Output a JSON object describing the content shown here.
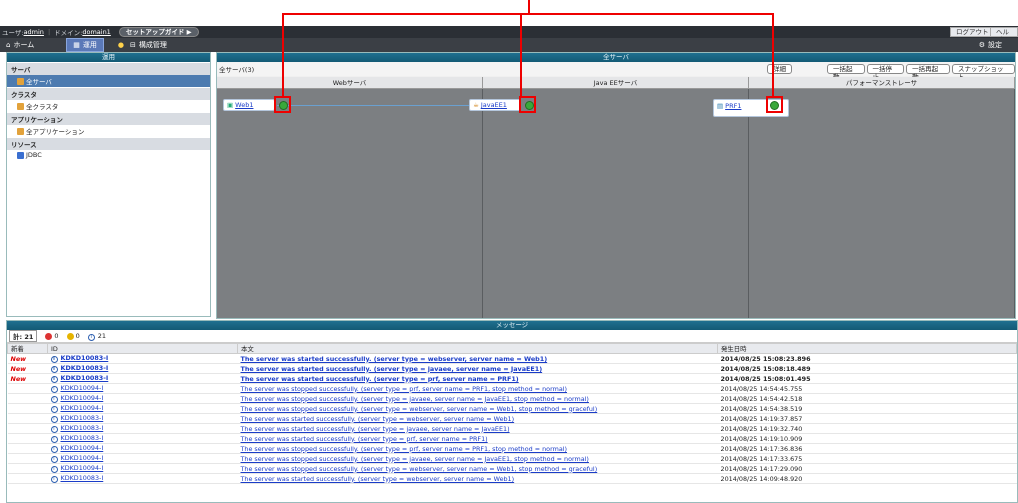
{
  "topbar": {
    "user_label": "ユーザ:",
    "user_name": "admin",
    "domain_label": "ドメイン:",
    "domain_name": "domain1",
    "setup_guide": "セットアップガイド",
    "logout": "ログアウト",
    "help": "ヘルプ"
  },
  "navbar": {
    "home": "ホーム",
    "operation": "運用",
    "config": "構成管理",
    "settings": "設定"
  },
  "left_panel": {
    "title": "運用",
    "sections": [
      {
        "label": "サーバ",
        "items": [
          {
            "label": "全サーバ",
            "selected": true
          }
        ]
      },
      {
        "label": "クラスタ",
        "items": [
          {
            "label": "全クラスタ",
            "selected": false
          }
        ]
      },
      {
        "label": "アプリケーション",
        "items": [
          {
            "label": "全アプリケーション",
            "selected": false
          }
        ]
      },
      {
        "label": "リソース",
        "items": [
          {
            "label": "JDBC",
            "selected": false
          }
        ]
      }
    ]
  },
  "main_panel": {
    "title": "全サーバ",
    "count_label": "全サーバ(3)",
    "detail_btn": "詳細",
    "buttons": [
      "一括起動",
      "一括停止",
      "一括再起動",
      "スナップショット"
    ],
    "columns": [
      "Webサーバ",
      "Java EEサーバ",
      "パフォーマンストレーサ"
    ],
    "nodes": [
      {
        "name": "Web1"
      },
      {
        "name": "JavaEE1"
      },
      {
        "name": "PRF1"
      }
    ]
  },
  "messages": {
    "title": "メッセージ",
    "total": "計: 21",
    "errors": "0",
    "warnings": "0",
    "infos": "21",
    "headers": [
      "新着",
      "ID",
      "本文",
      "発生日時"
    ],
    "rows": [
      {
        "new": "New",
        "id": "KDKD10083-I",
        "text": "The server was started successfully. (server type = webserver, server name = Web1)",
        "time": "2014/08/25 15:08:23.896"
      },
      {
        "new": "New",
        "id": "KDKD10083-I",
        "text": "The server was started successfully. (server type = javaee, server name = JavaEE1)",
        "time": "2014/08/25 15:08:18.489"
      },
      {
        "new": "New",
        "id": "KDKD10083-I",
        "text": "The server was started successfully. (server type = prf, server name = PRF1)",
        "time": "2014/08/25 15:08:01.495"
      },
      {
        "new": "",
        "id": "KDKD10094-I",
        "text": "The server was stopped successfully. (server type = prf, server name = PRF1, stop method = normal)",
        "time": "2014/08/25 14:54:45.755"
      },
      {
        "new": "",
        "id": "KDKD10094-I",
        "text": "The server was stopped successfully. (server type = javaee, server name = JavaEE1, stop method = normal)",
        "time": "2014/08/25 14:54:42.518"
      },
      {
        "new": "",
        "id": "KDKD10094-I",
        "text": "The server was stopped successfully. (server type = webserver, server name = Web1, stop method = graceful)",
        "time": "2014/08/25 14:54:38.519"
      },
      {
        "new": "",
        "id": "KDKD10083-I",
        "text": "The server was started successfully. (server type = webserver, server name = Web1)",
        "time": "2014/08/25 14:19:37.857"
      },
      {
        "new": "",
        "id": "KDKD10083-I",
        "text": "The server was started successfully. (server type = javaee, server name = JavaEE1)",
        "time": "2014/08/25 14:19:32.740"
      },
      {
        "new": "",
        "id": "KDKD10083-I",
        "text": "The server was started successfully. (server type = prf, server name = PRF1)",
        "time": "2014/08/25 14:19:10.909"
      },
      {
        "new": "",
        "id": "KDKD10094-I",
        "text": "The server was stopped successfully. (server type = prf, server name = PRF1, stop method = normal)",
        "time": "2014/08/25 14:17:36.836"
      },
      {
        "new": "",
        "id": "KDKD10094-I",
        "text": "The server was stopped successfully. (server type = javaee, server name = JavaEE1, stop method = normal)",
        "time": "2014/08/25 14:17:33.675"
      },
      {
        "new": "",
        "id": "KDKD10094-I",
        "text": "The server was stopped successfully. (server type = webserver, server name = Web1, stop method = graceful)",
        "time": "2014/08/25 14:17:29.090"
      },
      {
        "new": "",
        "id": "KDKD10083-I",
        "text": "The server was started successfully. (server type = webserver, server name = Web1)",
        "time": "2014/08/25 14:09:48.920"
      }
    ]
  }
}
